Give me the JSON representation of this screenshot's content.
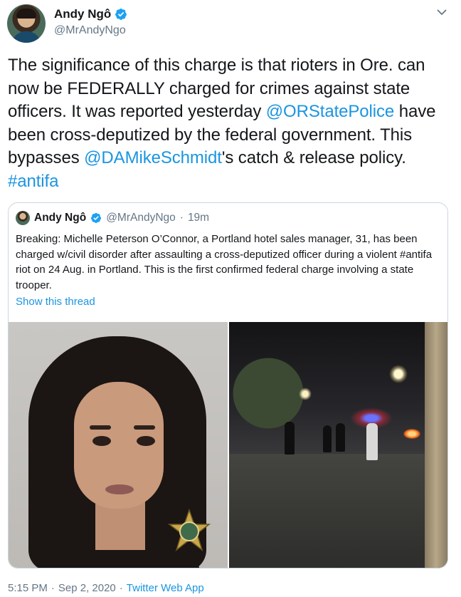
{
  "author": {
    "display_name": "Andy Ngô",
    "handle": "@MrAndyNgo"
  },
  "tweet": {
    "parts": [
      {
        "text": "The significance of this charge is that rioters in Ore. can now be FEDERALLY charged for crimes against state officers. It was reported yesterday ",
        "link": false
      },
      {
        "text": "@ORStatePolice",
        "link": true
      },
      {
        "text": " have been cross-deputized by the federal government. This bypasses ",
        "link": false
      },
      {
        "text": "@DAMikeSchmidt",
        "link": true
      },
      {
        "text": "'s catch & release policy. ",
        "link": false
      },
      {
        "text": "#antifa",
        "link": true
      }
    ]
  },
  "quoted_tweet": {
    "display_name": "Andy Ngô",
    "handle": "@MrAndyNgo",
    "separator": "·",
    "time": "19m",
    "text": "Breaking: Michelle Peterson O’Connor, a Portland hotel sales manager, 31, has been charged w/civil disorder after assaulting a cross-deputized officer during a violent #antifa riot on 24 Aug. in Portland. This is the first confirmed federal charge involving a state trooper.",
    "show_thread": "Show this thread"
  },
  "footer": {
    "time": "5:15 PM",
    "sep1": "·",
    "date": "Sep 2, 2020",
    "sep2": "·",
    "app": "Twitter Web App"
  },
  "colors": {
    "link": "#1b95e0",
    "muted": "#657786",
    "border": "#ccd6dd"
  },
  "icons": {
    "verified": "verified-badge-icon",
    "caret": "chevron-down-icon"
  }
}
